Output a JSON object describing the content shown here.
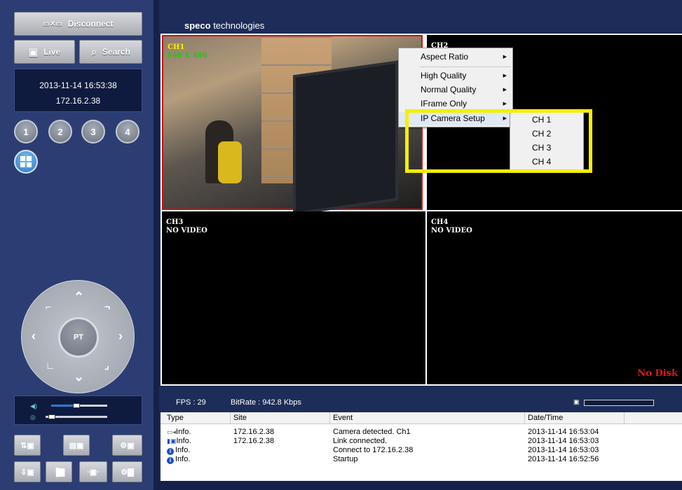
{
  "left_panel": {
    "disconnect_label": "Disconnect",
    "live_label": "Live",
    "search_label": "Search",
    "datetime": "2013-11-14 16:53:38",
    "ip": "172.16.2.38",
    "channel_buttons": [
      "1",
      "2",
      "3",
      "4"
    ],
    "ptz_label": "PT",
    "volume_level": 0.45,
    "mic_level": 0.1
  },
  "header": {
    "logo_bold": "speco",
    "logo_rest": " technologies"
  },
  "cameras": [
    {
      "label": "CH1",
      "sub": "640 X 480"
    },
    {
      "label": "CH2",
      "sub": ""
    },
    {
      "label": "CH3",
      "sub": "NO VIDEO"
    },
    {
      "label": "CH4",
      "sub": "NO VIDEO"
    }
  ],
  "no_disk": "No Disk",
  "context_menu": {
    "items": [
      "Aspect Ratio",
      "High Quality",
      "Normal Quality",
      "IFrame Only",
      "IP Camera Setup"
    ],
    "submenu": [
      "CH 1",
      "CH 2",
      "CH 3",
      "CH 4"
    ]
  },
  "status": {
    "fps": "FPS : 29",
    "bitrate": "BitRate : 942.8 Kbps"
  },
  "log": {
    "columns": [
      "Type",
      "Site",
      "Event",
      "Date/Time"
    ],
    "rows": [
      {
        "type": "Info.",
        "site": "172.16.2.38",
        "event": "Camera detected. Ch1",
        "time": "2013-11-14 16:53:04"
      },
      {
        "type": "Info.",
        "site": "172.16.2.38",
        "event": "Link connected.",
        "time": "2013-11-14 16:53:03"
      },
      {
        "type": "Info.",
        "site": "",
        "event": "Connect to 172.16.2.38",
        "time": "2013-11-14 16:53:03"
      },
      {
        "type": "Info.",
        "site": "",
        "event": "Startup",
        "time": "2013-11-14 16:52:56"
      }
    ]
  },
  "colors": {
    "panel": "#2b3d72",
    "highlight": "#f5ef00",
    "selected_border": "#d01010",
    "no_disk": "#e01818"
  }
}
